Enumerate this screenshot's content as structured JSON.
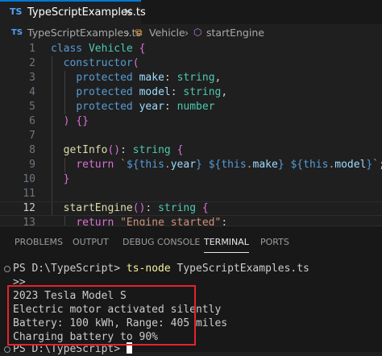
{
  "tab": {
    "lang_badge": "TS",
    "filename": "TypeScriptExamples.ts",
    "close": "×"
  },
  "breadcrumb": {
    "lang_badge": "TS",
    "file": "TypeScriptExamples.ts",
    "sep1": "›",
    "class": "Vehicle",
    "sep2": "›",
    "method": "startEngine"
  },
  "editor": {
    "active_line": 12,
    "lines": [
      {
        "n": "1",
        "text": "class Vehicle {"
      },
      {
        "n": "2",
        "text": "  constructor("
      },
      {
        "n": "3",
        "text": "    protected make: string,"
      },
      {
        "n": "4",
        "text": "    protected model: string,"
      },
      {
        "n": "5",
        "text": "    protected year: number"
      },
      {
        "n": "6",
        "text": "  ) {}"
      },
      {
        "n": "7",
        "text": ""
      },
      {
        "n": "8",
        "text": "  getInfo(): string {"
      },
      {
        "n": "9",
        "text": "    return `${this.year} ${this.make} ${this.model}`;"
      },
      {
        "n": "10",
        "text": "  }"
      },
      {
        "n": "11",
        "text": ""
      },
      {
        "n": "12",
        "text": "  startEngine(): string {"
      },
      {
        "n": "13",
        "text": "    return \"Engine started\";"
      }
    ]
  },
  "panel": {
    "tabs": [
      "PROBLEMS",
      "OUTPUT",
      "DEBUG CONSOLE",
      "TERMINAL",
      "PORTS"
    ],
    "active_tab": "TERMINAL"
  },
  "terminal": {
    "prompt": "PS D:\\TypeScript>",
    "command": "ts-node",
    "command_arg": "TypeScriptExamples.ts",
    "continuation": ">>",
    "output": [
      "2023 Tesla Model S",
      "Electric motor activated silently",
      "Battery: 100 kWh, Range: 405 miles",
      "Charging battery to 90%"
    ],
    "final_prompt": "PS D:\\TypeScript>"
  },
  "colors": {
    "highlight_box": "#e6222e",
    "accent": "#0078d4"
  }
}
